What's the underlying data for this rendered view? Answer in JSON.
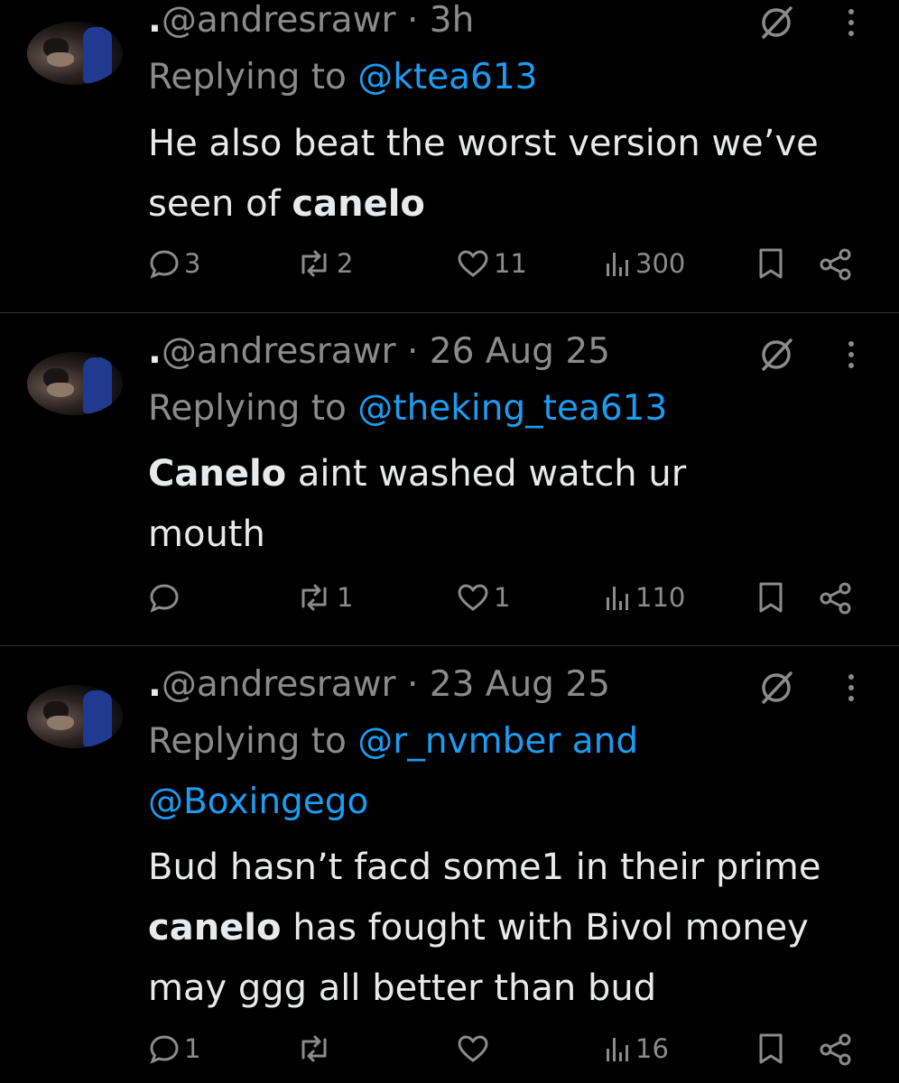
{
  "tweets": [
    {
      "dot": ".",
      "handle": "@andresrawr",
      "sep": " · ",
      "time": "3h",
      "reply_prefix": "Replying to ",
      "reply_line1": "@ktea613",
      "reply_line2": "",
      "text_parts": [
        {
          "t": "He also beat the worst version we’ve seen of ",
          "b": false
        },
        {
          "t": "canelo",
          "b": true
        }
      ],
      "replies": "3",
      "reposts": "2",
      "likes": "11",
      "views": "300"
    },
    {
      "dot": ".",
      "handle": "@andresrawr",
      "sep": " · ",
      "time": "26 Aug 25",
      "reply_prefix": "Replying to ",
      "reply_line1": "@theking_tea613",
      "reply_line2": "",
      "text_parts": [
        {
          "t": "Canelo",
          "b": true
        },
        {
          "t": " aint washed watch ur mouth",
          "b": false
        }
      ],
      "replies": "",
      "reposts": "1",
      "likes": "1",
      "views": "110"
    },
    {
      "dot": ".",
      "handle": "@andresrawr",
      "sep": " · ",
      "time": "23 Aug 25",
      "reply_prefix": "Replying to ",
      "reply_line1": "@r_nvmber and",
      "reply_line2": "@Boxingego",
      "text_parts": [
        {
          "t": "Bud hasn’t facd some1 in their prime ",
          "b": false
        },
        {
          "t": "canelo",
          "b": true
        },
        {
          "t": " has fought with Bivol money may ggg all better than bud",
          "b": false
        }
      ],
      "replies": "1",
      "reposts": "",
      "likes": "",
      "views": "16"
    }
  ],
  "icons": {
    "reply": "reply-icon",
    "repost": "repost-icon",
    "like": "heart-icon",
    "views": "views-icon",
    "bookmark": "bookmark-icon",
    "share": "share-icon",
    "grok": "grok-icon",
    "more": "more-icon"
  },
  "colors": {
    "background": "#000000",
    "text": "#e7e9ea",
    "muted": "#8b8b8b",
    "link": "#1d9bf0",
    "divider": "#2f3336"
  }
}
